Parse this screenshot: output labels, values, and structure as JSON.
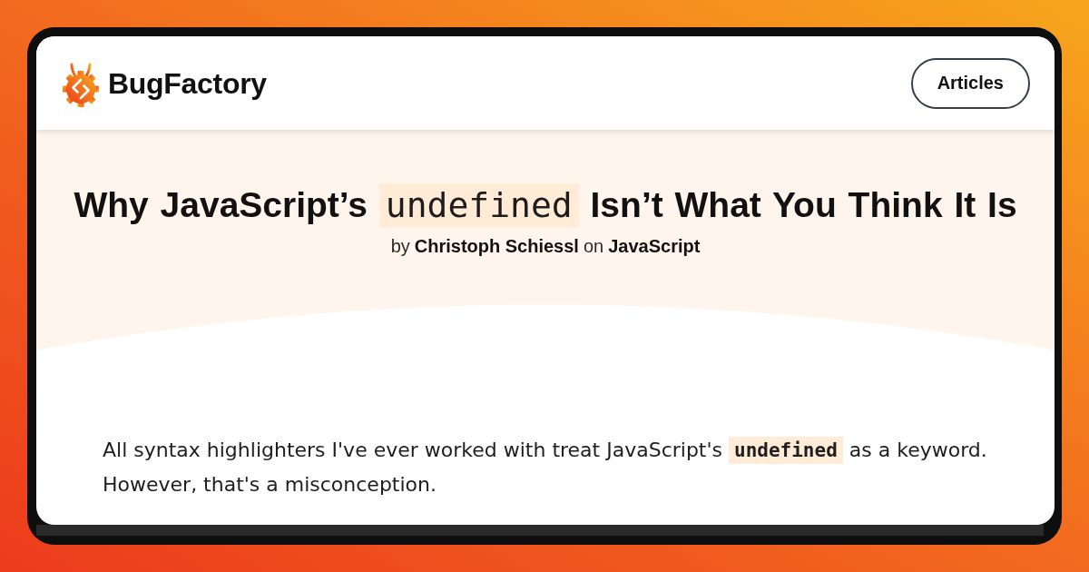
{
  "header": {
    "brand": "BugFactory",
    "nav_button": "Articles"
  },
  "article": {
    "title": {
      "before": "Why JavaScript’s",
      "code": "undefined",
      "after": "Isn’t What You Think It Is"
    },
    "byline": {
      "by": "by",
      "author": "Christoph Schiessl",
      "on": "on",
      "category": "JavaScript"
    },
    "intro": {
      "before": "All syntax highlighters I've ever worked with treat JavaScript's",
      "code": "undefined",
      "after": "as a keyword. However, that's a misconception."
    }
  }
}
